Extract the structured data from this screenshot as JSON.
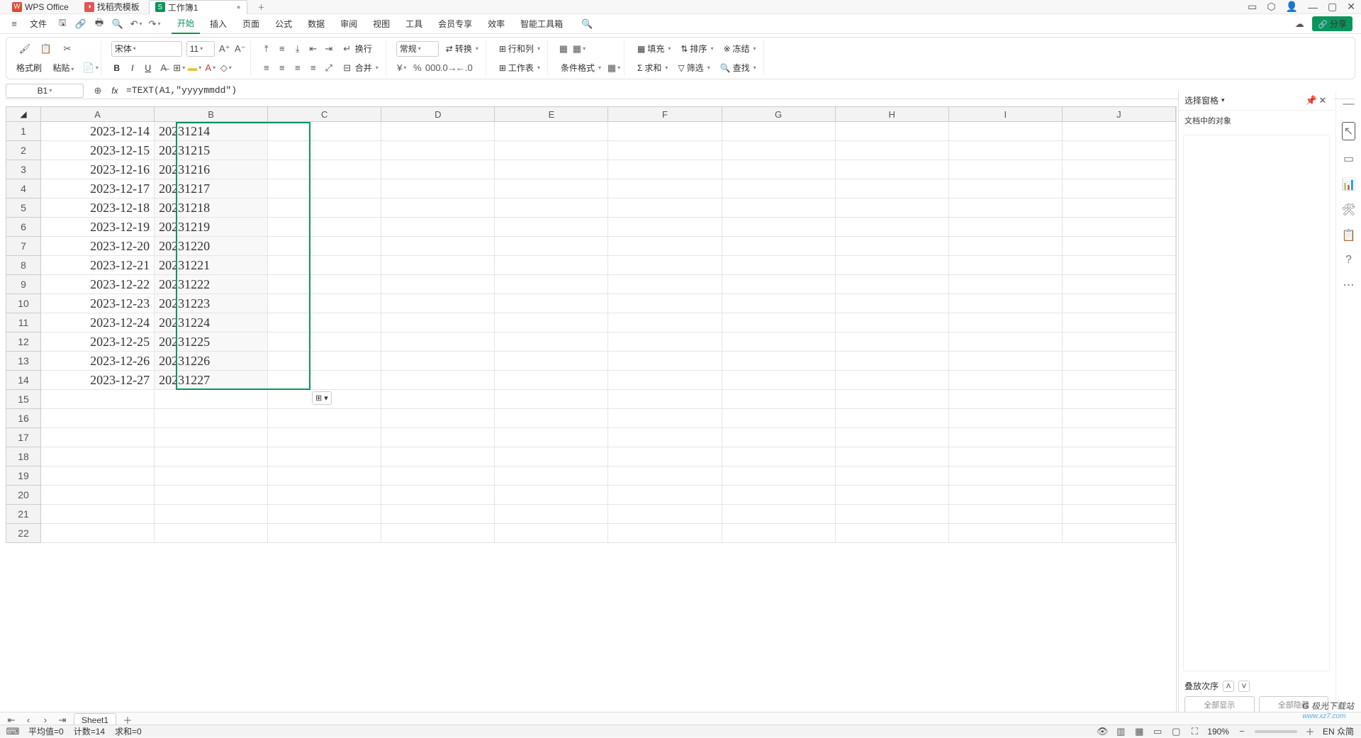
{
  "app": {
    "name": "WPS Office",
    "template_tab": "找稻壳模板",
    "workbook_tab": "工作簿1",
    "file_menu": "文件"
  },
  "menu": {
    "start": "开始",
    "insert": "插入",
    "page": "页面",
    "formula": "公式",
    "data": "数据",
    "review": "审阅",
    "view": "视图",
    "tool": "工具",
    "member": "会员专享",
    "eff": "效率",
    "ai": "智能工具箱"
  },
  "ribbon": {
    "format_painter": "格式刷",
    "paste": "粘贴",
    "font_name": "宋体",
    "font_size": "11",
    "number_format": "常规",
    "convert": "转换",
    "rowcol": "行和列",
    "worksheet": "工作表",
    "cond_format": "条件格式",
    "fill": "填充",
    "sort": "排序",
    "freeze": "冻结",
    "sum": "求和",
    "filter": "筛选",
    "find": "查找",
    "wrap": "换行",
    "merge": "合并"
  },
  "cellref": "B1",
  "formula": "=TEXT(A1,\"yyyymmdd\")",
  "columns": [
    "A",
    "B",
    "C",
    "D",
    "E",
    "F",
    "G",
    "H",
    "I",
    "J"
  ],
  "row_data": [
    {
      "a": "2023-12-14",
      "b": "20231214"
    },
    {
      "a": "2023-12-15",
      "b": "20231215"
    },
    {
      "a": "2023-12-16",
      "b": "20231216"
    },
    {
      "a": "2023-12-17",
      "b": "20231217"
    },
    {
      "a": "2023-12-18",
      "b": "20231218"
    },
    {
      "a": "2023-12-19",
      "b": "20231219"
    },
    {
      "a": "2023-12-20",
      "b": "20231220"
    },
    {
      "a": "2023-12-21",
      "b": "20231221"
    },
    {
      "a": "2023-12-22",
      "b": "20231222"
    },
    {
      "a": "2023-12-23",
      "b": "20231223"
    },
    {
      "a": "2023-12-24",
      "b": "20231224"
    },
    {
      "a": "2023-12-25",
      "b": "20231225"
    },
    {
      "a": "2023-12-26",
      "b": "20231226"
    },
    {
      "a": "2023-12-27",
      "b": "20231227"
    }
  ],
  "blank_rows": 22,
  "side": {
    "title": "选择窗格",
    "subtitle": "文档中的对象",
    "stack": "叠放次序",
    "show_all": "全部显示",
    "hide_all": "全部隐藏"
  },
  "sheet": {
    "name": "Sheet1"
  },
  "status": {
    "avg": "平均值=0",
    "count": "计数=14",
    "sum": "求和=0",
    "zoom": "190%",
    "share": "分享",
    "ime": "EN 众简"
  },
  "watermark": {
    "title": "极光下载站",
    "url": "www.xz7.com"
  }
}
